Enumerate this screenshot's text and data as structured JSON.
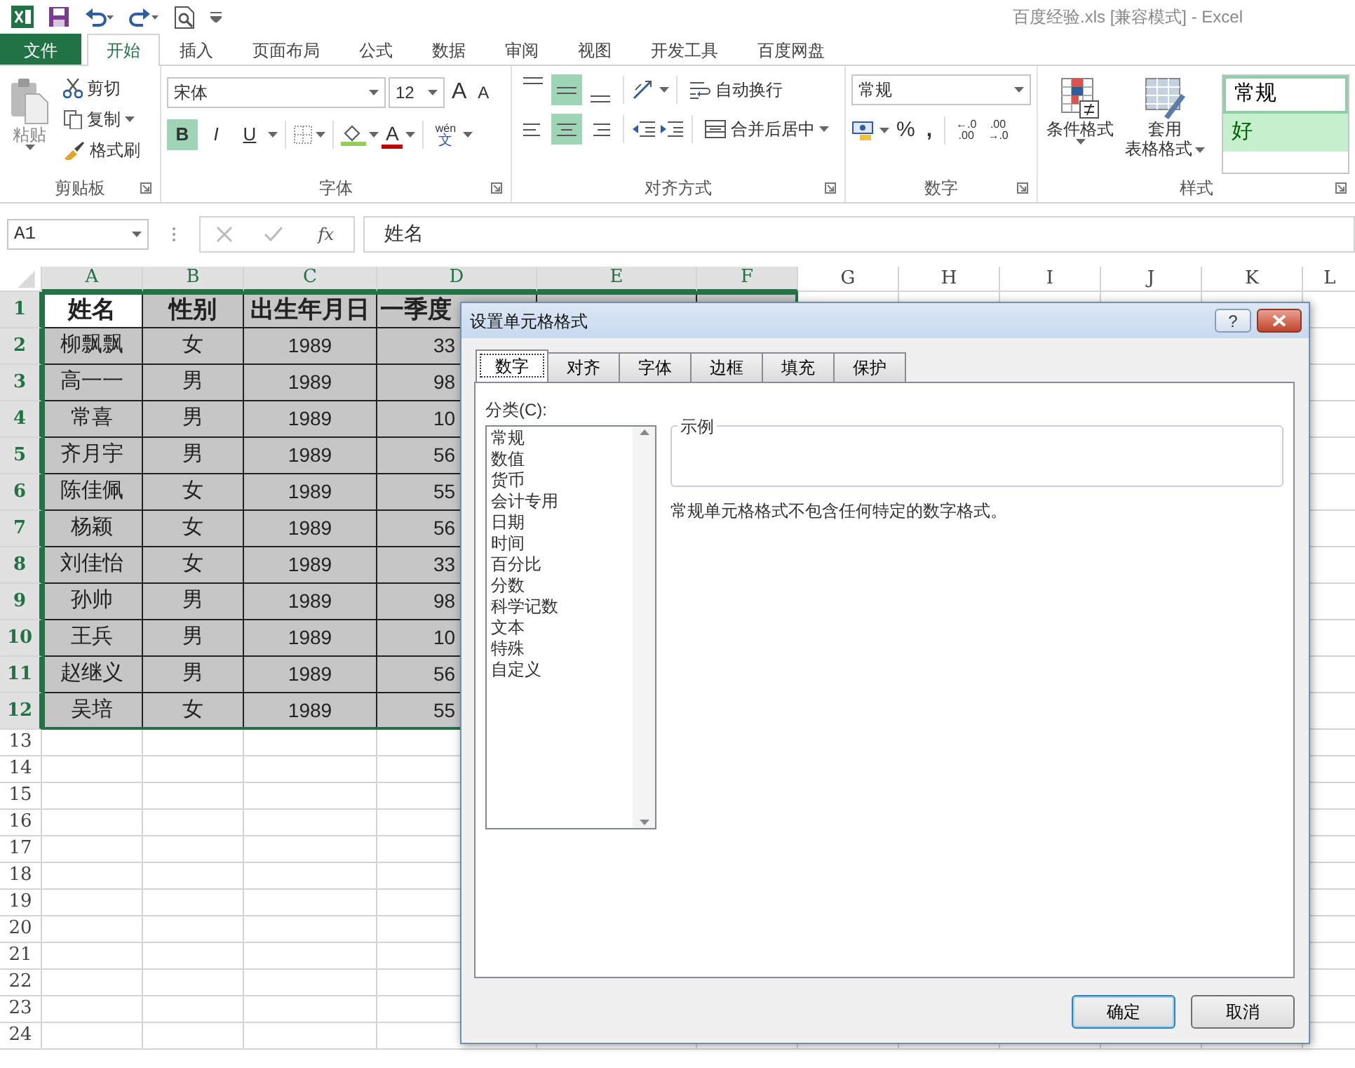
{
  "window": {
    "title": "百度经验.xls  [兼容模式] - Excel"
  },
  "ribbon_tabs": [
    {
      "label": "文件",
      "kind": "file",
      "selected": false
    },
    {
      "label": "开始",
      "kind": "tab",
      "selected": true
    },
    {
      "label": "插入",
      "kind": "tab",
      "selected": false
    },
    {
      "label": "页面布局",
      "kind": "tab",
      "selected": false
    },
    {
      "label": "公式",
      "kind": "tab",
      "selected": false
    },
    {
      "label": "数据",
      "kind": "tab",
      "selected": false
    },
    {
      "label": "审阅",
      "kind": "tab",
      "selected": false
    },
    {
      "label": "视图",
      "kind": "tab",
      "selected": false
    },
    {
      "label": "开发工具",
      "kind": "tab",
      "selected": false
    },
    {
      "label": "百度网盘",
      "kind": "tab",
      "selected": false
    }
  ],
  "clipboard": {
    "paste": "粘贴",
    "cut": "剪切",
    "copy": "复制",
    "format_painter": "格式刷",
    "label": "剪贴板"
  },
  "font": {
    "family": "宋体",
    "size": "12",
    "grow": "A",
    "shrink": "A",
    "styles": [
      {
        "glyph": "B",
        "kind": "bold",
        "on": true
      },
      {
        "glyph": "I",
        "kind": "italic",
        "on": false
      },
      {
        "glyph": "U",
        "kind": "underline",
        "on": false
      }
    ],
    "font_color": "A",
    "phonetic_top": "wén",
    "phonetic_bottom": "文",
    "label": "字体"
  },
  "alignment": {
    "vertical": [
      {
        "selected": false
      },
      {
        "selected": true
      },
      {
        "selected": false
      }
    ],
    "horizontal": [
      {
        "selected": false
      },
      {
        "selected": true
      },
      {
        "selected": false
      }
    ],
    "wrap": "自动换行",
    "merge": "合并后居中",
    "label": "对齐方式"
  },
  "number": {
    "format": "常规",
    "percent": "%",
    "comma": ",",
    "increase_decimal": [
      "←.0",
      ".00"
    ],
    "decrease_decimal": [
      ".00",
      "→.0"
    ],
    "label": "数字"
  },
  "styles": {
    "conditional": "条件格式",
    "table_format": "套用",
    "table_format_2": "表格格式",
    "gallery": [
      {
        "label": "常规",
        "kind": "normal"
      },
      {
        "label": "好",
        "kind": "good"
      }
    ],
    "label": "样式"
  },
  "formula_bar": {
    "name_box": "A1",
    "fx": "fx",
    "formula": "姓名"
  },
  "sheet": {
    "columns": [
      {
        "label": "A",
        "selected": true
      },
      {
        "label": "B",
        "selected": true
      },
      {
        "label": "C",
        "selected": true
      },
      {
        "label": "D",
        "selected": true
      },
      {
        "label": "E",
        "selected": true
      },
      {
        "label": "F",
        "selected": true
      },
      {
        "label": "G",
        "selected": false
      },
      {
        "label": "H",
        "selected": false
      },
      {
        "label": "I",
        "selected": false
      },
      {
        "label": "J",
        "selected": false
      },
      {
        "label": "K",
        "selected": false
      },
      {
        "label": "L",
        "selected": false
      }
    ],
    "row_numbers": [
      {
        "label": "1",
        "selected": true
      },
      {
        "label": "2",
        "selected": true
      },
      {
        "label": "3",
        "selected": true
      },
      {
        "label": "4",
        "selected": true
      },
      {
        "label": "5",
        "selected": true
      },
      {
        "label": "6",
        "selected": true
      },
      {
        "label": "7",
        "selected": true
      },
      {
        "label": "8",
        "selected": true
      },
      {
        "label": "9",
        "selected": true
      },
      {
        "label": "10",
        "selected": true
      },
      {
        "label": "11",
        "selected": true
      },
      {
        "label": "12",
        "selected": true
      },
      {
        "label": "13",
        "selected": false
      },
      {
        "label": "14",
        "selected": false
      },
      {
        "label": "15",
        "selected": false
      },
      {
        "label": "16",
        "selected": false
      },
      {
        "label": "17",
        "selected": false
      },
      {
        "label": "18",
        "selected": false
      },
      {
        "label": "19",
        "selected": false
      },
      {
        "label": "20",
        "selected": false
      },
      {
        "label": "21",
        "selected": false
      },
      {
        "label": "22",
        "selected": false
      },
      {
        "label": "23",
        "selected": false
      },
      {
        "label": "24",
        "selected": false
      }
    ],
    "header_row": [
      {
        "text": "姓名",
        "active": true
      },
      {
        "text": "性别",
        "active": false
      },
      {
        "text": "出生年月日",
        "active": false
      },
      {
        "text": "一季度",
        "active": false
      }
    ],
    "rows": [
      [
        "柳飘飘",
        "女",
        "1989",
        "33"
      ],
      [
        "高一一",
        "男",
        "1989",
        "98"
      ],
      [
        "常喜",
        "男",
        "1989",
        "10"
      ],
      [
        "齐月宇",
        "男",
        "1989",
        "56"
      ],
      [
        "陈佳佩",
        "女",
        "1989",
        "55"
      ],
      [
        "杨颖",
        "女",
        "1989",
        "56"
      ],
      [
        "刘佳怡",
        "女",
        "1989",
        "33"
      ],
      [
        "孙帅",
        "男",
        "1989",
        "98"
      ],
      [
        "王兵",
        "男",
        "1989",
        "10"
      ],
      [
        "赵继义",
        "男",
        "1989",
        "56"
      ],
      [
        "吴培",
        "女",
        "1989",
        "55"
      ]
    ]
  },
  "dialog": {
    "title": "设置单元格格式",
    "help": "?",
    "tabs": [
      {
        "label": "数字",
        "selected": true
      },
      {
        "label": "对齐",
        "selected": false
      },
      {
        "label": "字体",
        "selected": false
      },
      {
        "label": "边框",
        "selected": false
      },
      {
        "label": "填充",
        "selected": false
      },
      {
        "label": "保护",
        "selected": false
      }
    ],
    "category_label": "分类(C):",
    "categories": [
      "常规",
      "数值",
      "货币",
      "会计专用",
      "日期",
      "时间",
      "百分比",
      "分数",
      "科学记数",
      "文本",
      "特殊",
      "自定义"
    ],
    "sample_label": "示例",
    "description": "常规单元格格式不包含任何特定的数字格式。",
    "buttons": [
      {
        "label": "确定",
        "kind": "default"
      },
      {
        "label": "取消",
        "kind": "normal"
      }
    ]
  }
}
